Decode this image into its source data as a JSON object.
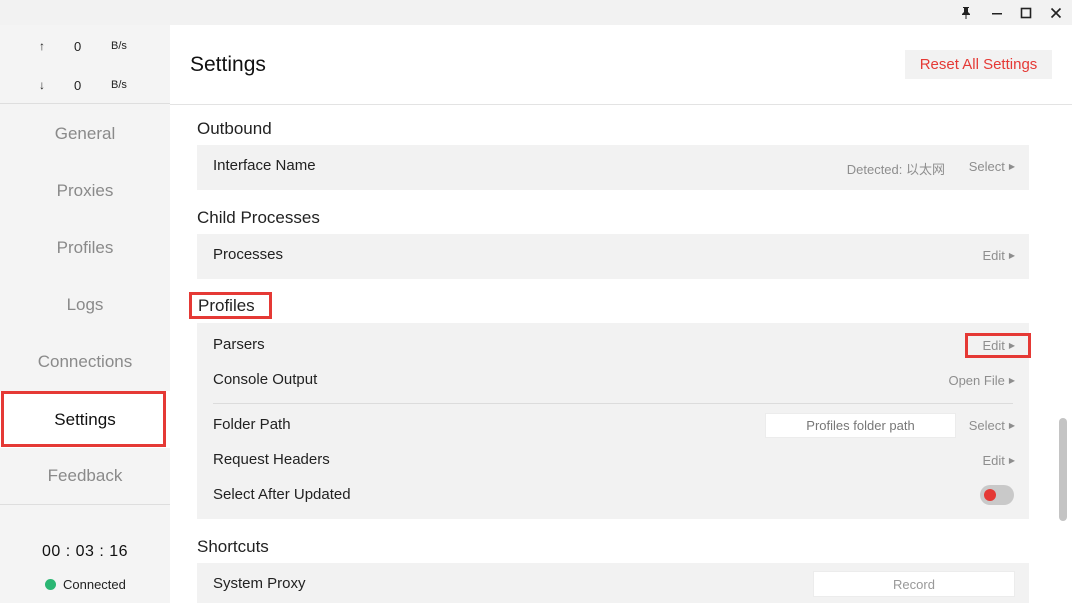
{
  "window": {
    "controls": [
      "pin-icon",
      "minimize-icon",
      "maximize-icon",
      "close-icon"
    ]
  },
  "sidebar": {
    "traffic": {
      "up": {
        "arrow": "↑",
        "value": "0",
        "unit": "B/s"
      },
      "down": {
        "arrow": "↓",
        "value": "0",
        "unit": "B/s"
      }
    },
    "items": [
      {
        "label": "General"
      },
      {
        "label": "Proxies"
      },
      {
        "label": "Profiles"
      },
      {
        "label": "Logs"
      },
      {
        "label": "Connections"
      },
      {
        "label": "Settings",
        "active": true
      },
      {
        "label": "Feedback"
      }
    ],
    "clock": "00 : 03 : 16",
    "status": "Connected",
    "status_color": "#2bb673"
  },
  "header": {
    "title": "Settings",
    "reset_label": "Reset All Settings"
  },
  "sections": {
    "outbound": {
      "title": "Outbound",
      "interface_name": {
        "label": "Interface Name",
        "detected": "Detected: 以太网",
        "action": "Select"
      }
    },
    "child_processes": {
      "title": "Child Processes",
      "processes": {
        "label": "Processes",
        "action": "Edit"
      }
    },
    "profiles": {
      "title": "Profiles",
      "parsers": {
        "label": "Parsers",
        "action": "Edit"
      },
      "console_output": {
        "label": "Console Output",
        "action": "Open File"
      },
      "folder_path": {
        "label": "Folder Path",
        "placeholder": "Profiles folder path",
        "action": "Select"
      },
      "request_headers": {
        "label": "Request Headers",
        "action": "Edit"
      },
      "select_after_updated": {
        "label": "Select After Updated",
        "enabled": false
      }
    },
    "shortcuts": {
      "title": "Shortcuts",
      "system_proxy": {
        "label": "System Proxy",
        "placeholder": "Record"
      }
    }
  },
  "colors": {
    "accent": "#e53935",
    "highlight": "#e53935"
  }
}
